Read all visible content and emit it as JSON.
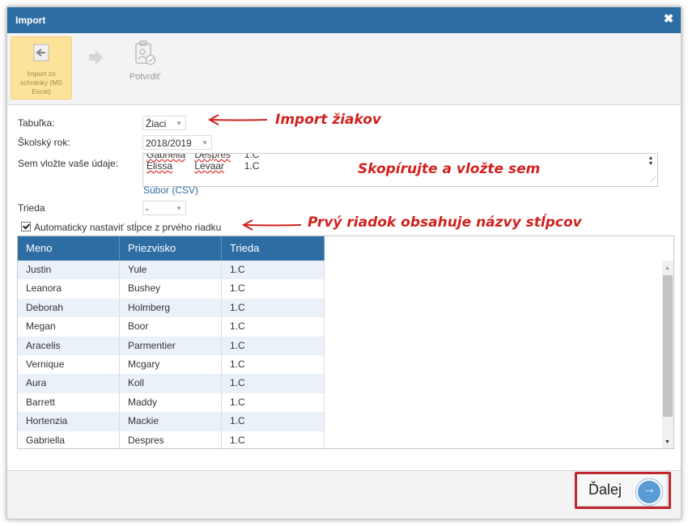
{
  "dialog": {
    "title": "Import",
    "close_symbol": "✖"
  },
  "toolbar": {
    "import_label": "Import zo schránky (MS Excel)",
    "confirm_label": "Potvrdiť"
  },
  "form": {
    "table_label": "Tabuľka:",
    "table_value": "Žiaci",
    "year_label": "Školský rok:",
    "year_value": "2018/2019",
    "paste_label": "Sem vložte vaše údaje:",
    "paste_lines": [
      {
        "first": "Gabriella",
        "last": "Despres",
        "cls": "1.C"
      },
      {
        "first": "Elissa",
        "last": "Levaar",
        "cls": "1.C"
      }
    ],
    "file_link": "Súbor (CSV)",
    "class_label": "Trieda",
    "class_value": "-",
    "auto_columns_label": "Automaticky nastaviť stĺpce z prvého riadku",
    "auto_columns_checked": true
  },
  "grid": {
    "columns": [
      "Meno",
      "Priezvisko",
      "Trieda"
    ],
    "rows": [
      [
        "Justin",
        "Yule",
        "1.C"
      ],
      [
        "Leanora",
        "Bushey",
        "1.C"
      ],
      [
        "Deborah",
        "Holmberg",
        "1.C"
      ],
      [
        "Megan",
        "Boor",
        "1.C"
      ],
      [
        "Aracelis",
        "Parmentier",
        "1.C"
      ],
      [
        "Vernique",
        "Mcgary",
        "1.C"
      ],
      [
        "Aura",
        "Koll",
        "1.C"
      ],
      [
        "Barrett",
        "Maddy",
        "1.C"
      ],
      [
        "Hortenzia",
        "Mackie",
        "1.C"
      ],
      [
        "Gabriella",
        "Despres",
        "1.C"
      ]
    ]
  },
  "footer": {
    "next_label": "Ďalej",
    "next_icon": "arrow-right-circle-icon"
  },
  "annotations": {
    "import_students": "Import žiakov",
    "copy_paste": "Skopírujte a vložte sem",
    "first_row_names": "Prvý riadok obsahuje názvy stĺpcov"
  },
  "colors": {
    "header_blue": "#2e6da4",
    "annotation_red": "#d0221f",
    "highlight_yellow": "#fde39a"
  }
}
